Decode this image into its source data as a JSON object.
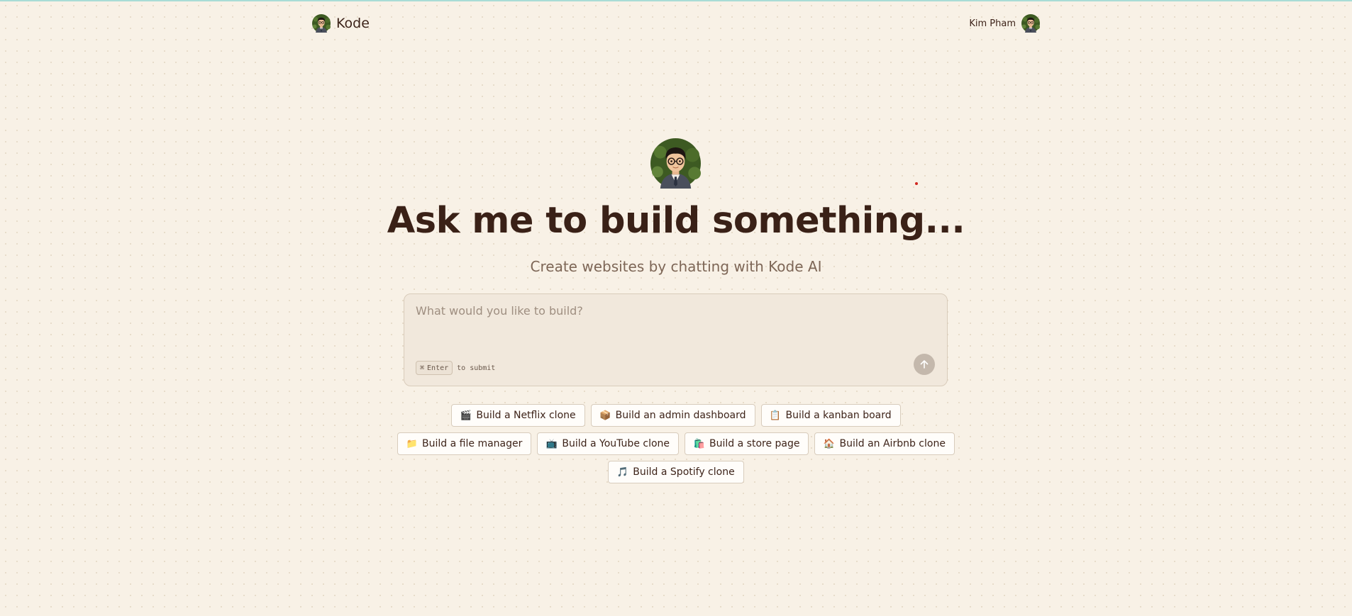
{
  "header": {
    "brand": "Kode",
    "user_name": "Kim Pham"
  },
  "hero": {
    "title": "Ask me to build something...",
    "subtitle": "Create websites by chatting with Kode AI"
  },
  "prompt": {
    "placeholder": "What would you like to build?",
    "shortcut_key": "Enter",
    "shortcut_symbol": "⌘",
    "shortcut_text": "to submit",
    "send_icon": "arrow-up-icon"
  },
  "suggestions": {
    "row1": [
      {
        "emoji": "🎬",
        "icon": "clapperboard-icon",
        "label": "Build a Netflix clone"
      },
      {
        "emoji": "📦",
        "icon": "package-icon",
        "label": "Build an admin dashboard"
      },
      {
        "emoji": "📋",
        "icon": "clipboard-icon",
        "label": "Build a kanban board"
      }
    ],
    "row2": [
      {
        "emoji": "📁",
        "icon": "folder-icon",
        "label": "Build a file manager"
      },
      {
        "emoji": "📺",
        "icon": "tv-icon",
        "label": "Build a YouTube clone"
      },
      {
        "emoji": "🛍️",
        "icon": "shopping-bags-icon",
        "label": "Build a store page"
      },
      {
        "emoji": "🏠",
        "icon": "house-icon",
        "label": "Build an Airbnb clone"
      }
    ],
    "row3": [
      {
        "emoji": "🎵",
        "icon": "music-note-icon",
        "label": "Build a Spotify clone"
      }
    ]
  },
  "colors": {
    "background": "#f8f1e6",
    "text": "#3d2319",
    "muted": "#7d6656",
    "input_bg": "#f1e8dc",
    "send_button": "#c4b8ac"
  }
}
